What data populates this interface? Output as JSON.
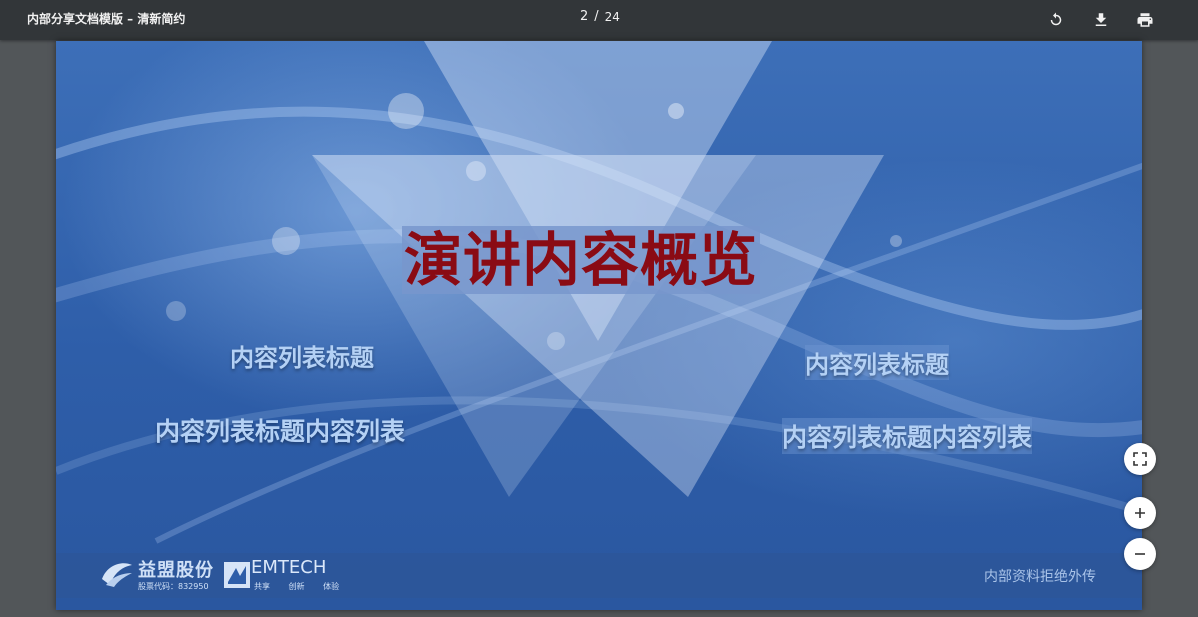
{
  "toolbar": {
    "title": "内部分享文档模版 – 清新简约",
    "page_current": "2",
    "page_separator": "/",
    "page_total": "24",
    "icons": [
      "rotate-icon",
      "download-icon",
      "print-icon"
    ]
  },
  "slide": {
    "heading": "演讲内容概览",
    "items": [
      "内容列表标题",
      "内容列表标题",
      "内容列表标题内容列表",
      "内容列表标题内容列表"
    ],
    "footer": {
      "logo1_name": "益盟股份",
      "logo1_code": "股票代码：832950",
      "logo2_name": "EMTECH",
      "logo2_tagline": "共享 创新 体验",
      "confidential": "内部资料拒绝外传"
    },
    "colors": {
      "background": "#2e5ea9",
      "heading_text": "#8a0b14",
      "item_text": "#b4d1f5"
    }
  },
  "controls": {
    "icons": [
      "fit-page-icon",
      "zoom-in-icon",
      "zoom-out-icon"
    ]
  }
}
